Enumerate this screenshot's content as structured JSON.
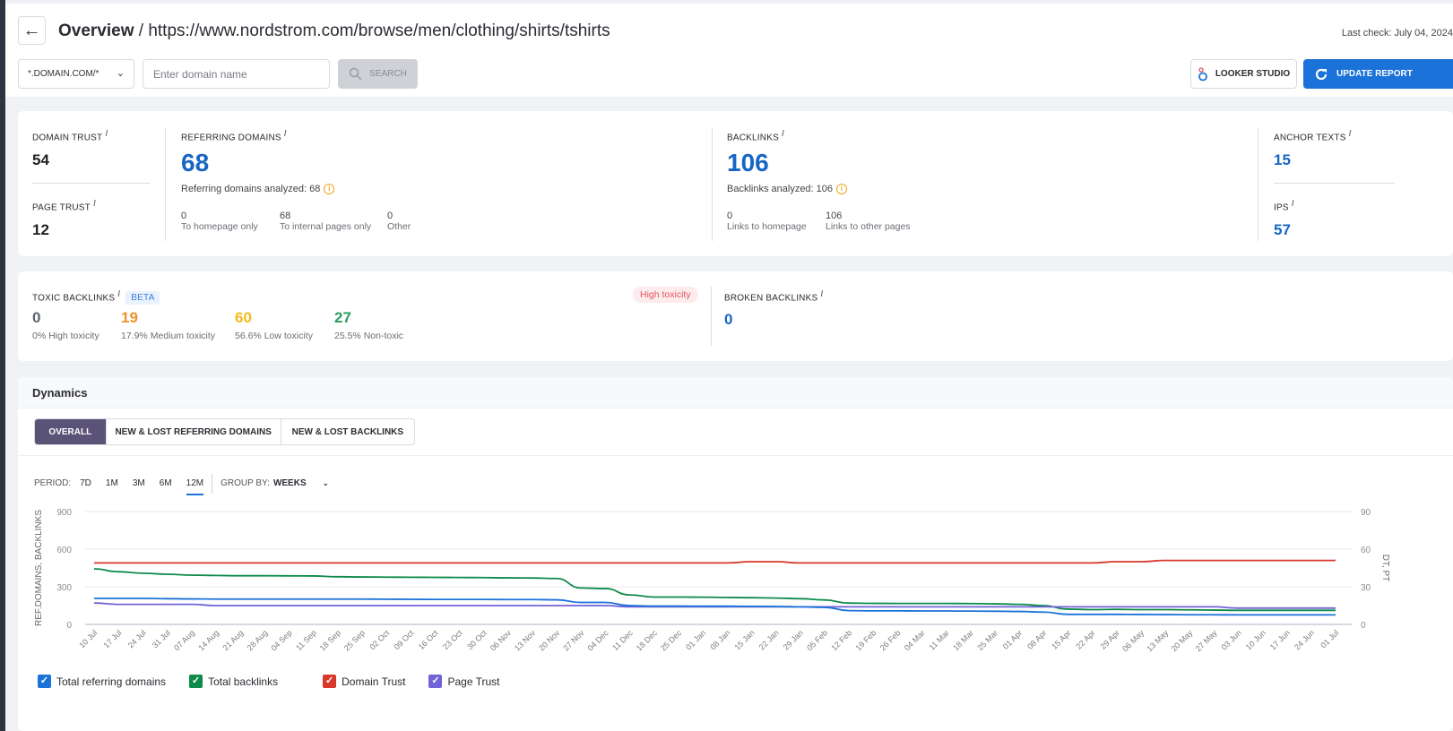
{
  "header": {
    "back_icon": "arrow-left-icon",
    "title_bold": "Overview",
    "title_rest": " / https://www.nordstrom.com/browse/men/clothing/shirts/tshirts",
    "last_check": "Last check: July 04, 2024"
  },
  "search": {
    "scope_value": "*.DOMAIN.COM/*",
    "placeholder": "Enter domain name",
    "value": "",
    "search_label": "SEARCH"
  },
  "actions": {
    "looker_label": "LOOKER STUDIO",
    "update_label": "UPDATE REPORT"
  },
  "metrics": {
    "domain_trust": {
      "label": "DOMAIN TRUST",
      "value": "54"
    },
    "page_trust": {
      "label": "PAGE TRUST",
      "value": "12"
    },
    "referring_domains": {
      "label": "REFERRING DOMAINS",
      "value": "68",
      "analyzed": "Referring domains analyzed: 68",
      "breakdown": [
        {
          "value": "0",
          "label": "To homepage only"
        },
        {
          "value": "68",
          "label": "To internal pages only"
        },
        {
          "value": "0",
          "label": "Other"
        }
      ]
    },
    "backlinks": {
      "label": "BACKLINKS",
      "value": "106",
      "analyzed": "Backlinks analyzed: 106",
      "breakdown": [
        {
          "value": "0",
          "label": "Links to homepage"
        },
        {
          "value": "106",
          "label": "Links to other pages"
        }
      ]
    },
    "anchor_texts": {
      "label": "ANCHOR TEXTS",
      "value": "15"
    },
    "ips": {
      "label": "IPS",
      "value": "57"
    }
  },
  "toxic": {
    "label": "TOXIC BACKLINKS",
    "badge": "BETA",
    "status_pill": "High toxicity",
    "items": [
      {
        "value": "0",
        "label": "0% High toxicity",
        "color": "#5f6470"
      },
      {
        "value": "19",
        "label": "17.9% Medium toxicity",
        "color": "#f0922b"
      },
      {
        "value": "60",
        "label": "56.6% Low toxicity",
        "color": "#f2bb1c"
      },
      {
        "value": "27",
        "label": "25.5% Non-toxic",
        "color": "#2e9b5f"
      }
    ]
  },
  "broken": {
    "label": "BROKEN BACKLINKS",
    "value": "0"
  },
  "dynamics": {
    "title": "Dynamics",
    "tabs": [
      "OVERALL",
      "NEW & LOST REFERRING DOMAINS",
      "NEW & LOST BACKLINKS"
    ],
    "active_tab": 0,
    "period_label": "PERIOD:",
    "periods": [
      "7D",
      "1M",
      "3M",
      "6M",
      "12M"
    ],
    "active_period": "12M",
    "group_by_label": "GROUP BY:",
    "group_by_value": "WEEKS"
  },
  "chart_data": {
    "type": "line",
    "x": [
      "10 Jul",
      "17 Jul",
      "24 Jul",
      "31 Jul",
      "07 Aug",
      "14 Aug",
      "21 Aug",
      "28 Aug",
      "04 Sep",
      "11 Sep",
      "18 Sep",
      "25 Sep",
      "02 Oct",
      "09 Oct",
      "16 Oct",
      "23 Oct",
      "30 Oct",
      "06 Nov",
      "13 Nov",
      "20 Nov",
      "27 Nov",
      "04 Dec",
      "11 Dec",
      "18 Dec",
      "25 Dec",
      "01 Jan",
      "08 Jan",
      "15 Jan",
      "22 Jan",
      "29 Jan",
      "05 Feb",
      "12 Feb",
      "19 Feb",
      "26 Feb",
      "04 Mar",
      "11 Mar",
      "18 Mar",
      "25 Mar",
      "01 Apr",
      "08 Apr",
      "15 Apr",
      "22 Apr",
      "29 Apr",
      "06 May",
      "13 May",
      "20 May",
      "27 May",
      "03 Jun",
      "10 Jun",
      "17 Jun",
      "24 Jun",
      "01 Jul"
    ],
    "ylabel_left": "REF.DOMAINS, BACKLINKS",
    "ylabel_right": "DT, PT",
    "ylim_left": [
      0,
      900
    ],
    "ylim_right": [
      0,
      90
    ],
    "yticks_left": [
      0,
      300,
      600,
      900
    ],
    "yticks_right": [
      0,
      30,
      60,
      90
    ],
    "grid": true,
    "legend_position": "bottom-left",
    "series": [
      {
        "name": "Total referring domains",
        "axis": "left",
        "color": "#1b72d8",
        "values": [
          207,
          207,
          207,
          205,
          203,
          202,
          202,
          202,
          202,
          202,
          202,
          202,
          201,
          200,
          199,
          199,
          199,
          198,
          198,
          196,
          175,
          175,
          150,
          146,
          146,
          145,
          145,
          144,
          143,
          140,
          136,
          110,
          108,
          108,
          107,
          107,
          106,
          105,
          103,
          98,
          80,
          80,
          80,
          79,
          78,
          77,
          77,
          76,
          76,
          76,
          76,
          76
        ]
      },
      {
        "name": "Total backlinks",
        "axis": "left",
        "color": "#0e8a4a",
        "values": [
          443,
          420,
          408,
          400,
          393,
          390,
          388,
          388,
          387,
          386,
          380,
          378,
          377,
          376,
          375,
          374,
          373,
          371,
          370,
          366,
          290,
          286,
          235,
          218,
          218,
          217,
          215,
          213,
          210,
          205,
          195,
          170,
          168,
          167,
          167,
          167,
          166,
          164,
          160,
          150,
          122,
          118,
          120,
          118,
          118,
          116,
          114,
          112,
          112,
          112,
          112,
          112
        ]
      },
      {
        "name": "Domain Trust",
        "axis": "right",
        "color": "#d9392b",
        "values": [
          49,
          49,
          49,
          49,
          49,
          49,
          49,
          49,
          49,
          49,
          49,
          49,
          49,
          49,
          49,
          49,
          49,
          49,
          49,
          49,
          49,
          49,
          49,
          49,
          49,
          49,
          49,
          50,
          50,
          49,
          49,
          49,
          49,
          49,
          49,
          49,
          49,
          49,
          49,
          49,
          49,
          49,
          50,
          50,
          51,
          51,
          51,
          51,
          51,
          51,
          51,
          51
        ]
      },
      {
        "name": "Page Trust",
        "axis": "right",
        "color": "#7163d8",
        "values": [
          17,
          16,
          16,
          16,
          16,
          15,
          15,
          15,
          15,
          15,
          15,
          15,
          15,
          15,
          15,
          15,
          15,
          15,
          15,
          15,
          15,
          15,
          14,
          14,
          14,
          14,
          14,
          14,
          14,
          14,
          14,
          14,
          14,
          14,
          14,
          14,
          14,
          14,
          14,
          14,
          14,
          14,
          14,
          14,
          14,
          14,
          14,
          13,
          13,
          13,
          13,
          13
        ]
      }
    ]
  },
  "legend": [
    {
      "label": "Total referring domains",
      "color": "#1b72d8",
      "checked": true
    },
    {
      "label": "Total backlinks",
      "color": "#0e8a4a",
      "checked": true
    },
    {
      "label": "Domain Trust",
      "color": "#d9392b",
      "checked": true
    },
    {
      "label": "Page Trust",
      "color": "#7163d8",
      "checked": true
    }
  ]
}
